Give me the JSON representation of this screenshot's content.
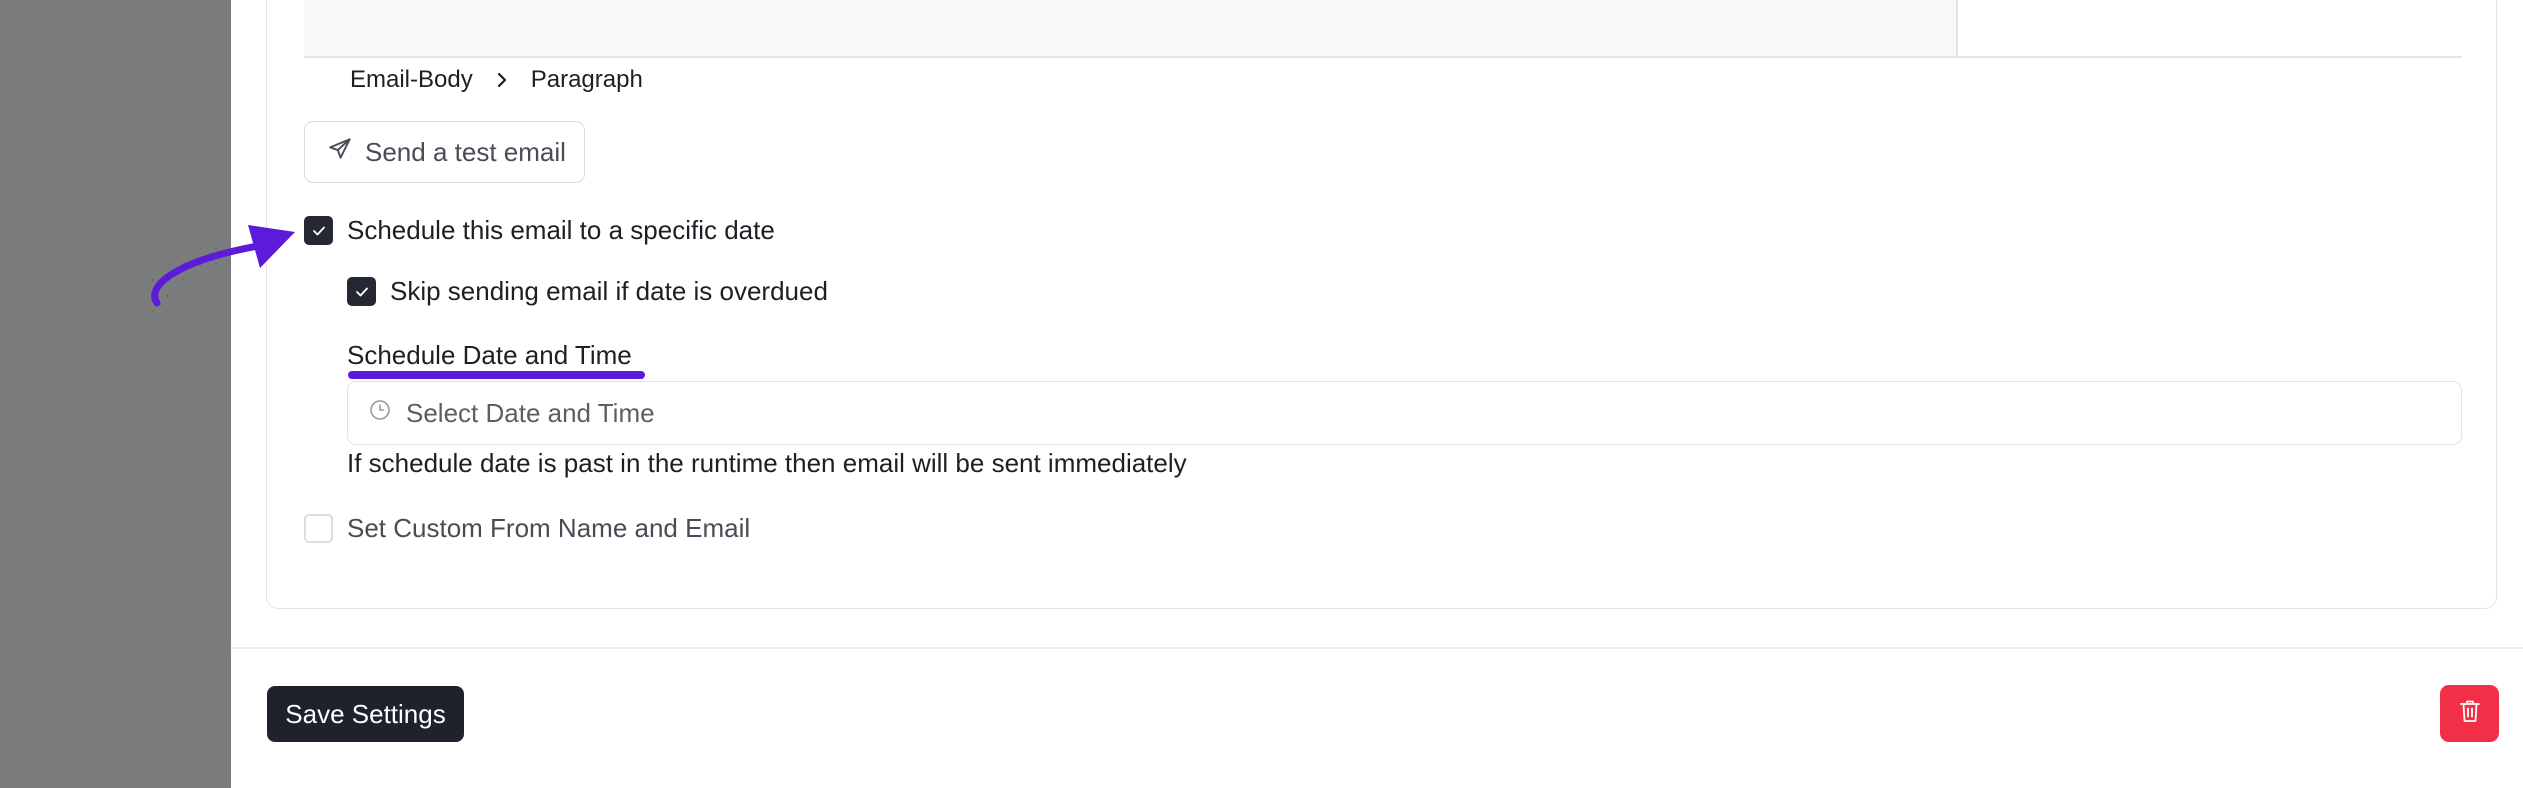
{
  "breadcrumb": {
    "items": [
      "Email-Body",
      "Paragraph"
    ]
  },
  "test_email": {
    "label": "Send a test email",
    "icon": "send-icon"
  },
  "schedule": {
    "label": "Schedule this email to a specific date",
    "checked": true
  },
  "skip_overdue": {
    "label": "Skip sending email if date is overdued",
    "checked": true
  },
  "date_field": {
    "label": "Schedule Date and Time",
    "placeholder": "Select Date and Time",
    "icon": "clock-icon",
    "help": "If schedule date is past in the runtime then email will be sent immediately"
  },
  "custom_from": {
    "label": "Set Custom From Name and Email",
    "checked": false
  },
  "footer": {
    "save_label": "Save Settings",
    "delete_icon": "trash-icon"
  },
  "colors": {
    "accent": "#5b1bd9",
    "primary_button": "#1f222c",
    "danger": "#f12f46"
  }
}
